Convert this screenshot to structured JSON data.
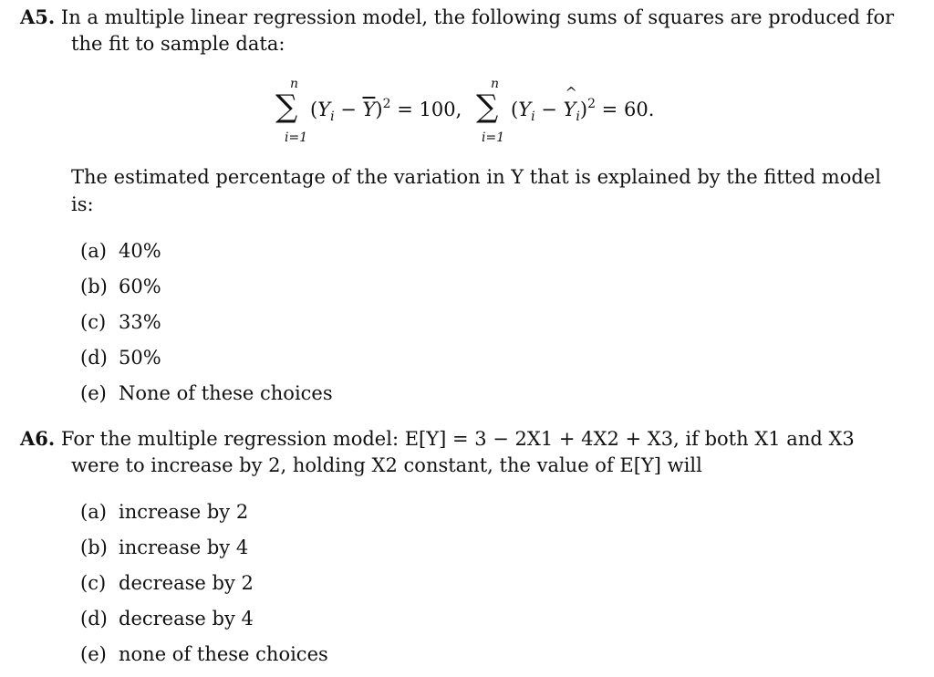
{
  "questions": [
    {
      "number": "A5.",
      "stem_line1": "In a multiple linear regression model, the following sums of squares are produced for",
      "stem_line2": "the fit to sample data:",
      "equation": {
        "sum_upper": "n",
        "sum_lower": "i=1",
        "sst_expr": "(Yi − Ȳ)² = 100,",
        "sst_value": "100",
        "sse_expr": "(Yi − Ŷi)² = 60.",
        "sse_value": "60"
      },
      "prompt_line1": "The estimated percentage of the variation in Y that is explained by the fitted model",
      "prompt_line2": "is:",
      "options": [
        {
          "label": "(a)",
          "text": "40%"
        },
        {
          "label": "(b)",
          "text": "60%"
        },
        {
          "label": "(c)",
          "text": "33%"
        },
        {
          "label": "(d)",
          "text": "50%"
        },
        {
          "label": "(e)",
          "text": "None of these choices"
        }
      ]
    },
    {
      "number": "A6.",
      "stem_line1": "For the multiple regression model: E[Y] = 3 − 2X1 + 4X2 + X3, if both X1 and X3",
      "stem_line2": "were to increase by 2, holding X2 constant, the value of E[Y] will",
      "options": [
        {
          "label": "(a)",
          "text": "increase by 2"
        },
        {
          "label": "(b)",
          "text": "increase by 4"
        },
        {
          "label": "(c)",
          "text": "decrease by 2"
        },
        {
          "label": "(d)",
          "text": "decrease by 4"
        },
        {
          "label": "(e)",
          "text": "none of these choices"
        }
      ]
    }
  ]
}
